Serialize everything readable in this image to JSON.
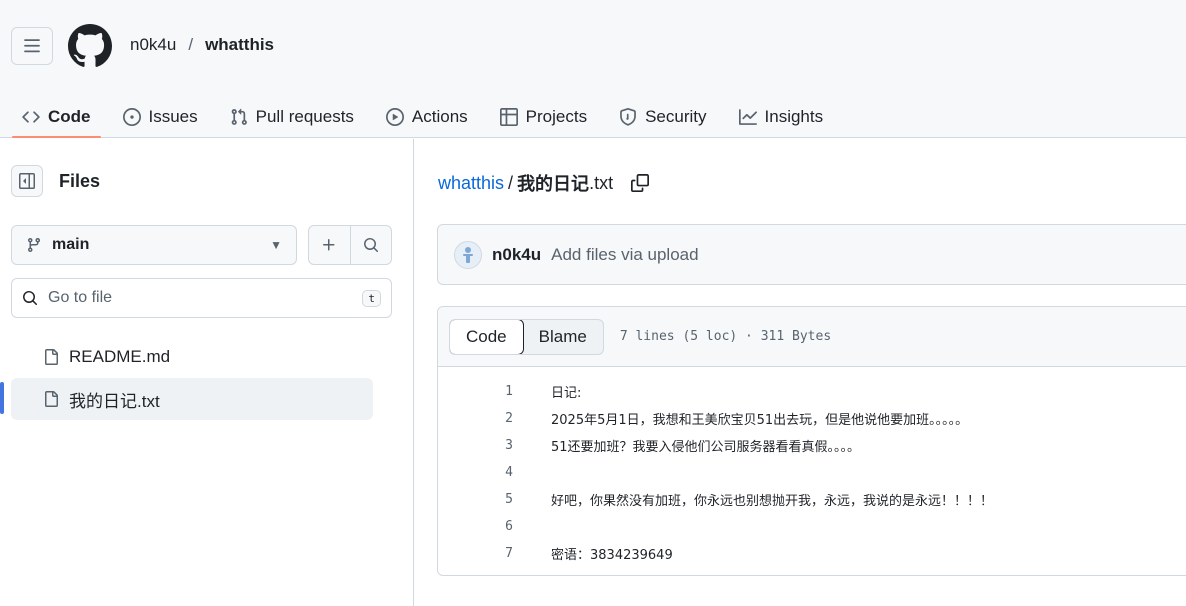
{
  "header": {
    "owner": "n0k4u",
    "separator": "/",
    "repo": "whatthis",
    "tabs": [
      {
        "label": "Code",
        "icon": "code-icon",
        "active": true
      },
      {
        "label": "Issues",
        "icon": "issue-opened-icon"
      },
      {
        "label": "Pull requests",
        "icon": "git-pull-request-icon"
      },
      {
        "label": "Actions",
        "icon": "play-icon"
      },
      {
        "label": "Projects",
        "icon": "table-icon"
      },
      {
        "label": "Security",
        "icon": "shield-icon"
      },
      {
        "label": "Insights",
        "icon": "graph-icon"
      }
    ]
  },
  "sidebar": {
    "title": "Files",
    "branch": "main",
    "goto_placeholder": "Go to file",
    "goto_shortcut": "t",
    "items": [
      {
        "label": "README.md",
        "selected": false
      },
      {
        "label": "我的日记.txt",
        "selected": true
      }
    ]
  },
  "main": {
    "breadcrumb_root": "whatthis",
    "breadcrumb_sep": "/",
    "breadcrumb_file_bold": "我的日记",
    "breadcrumb_file_ext": ".txt",
    "commit_author": "n0k4u",
    "commit_message": "Add files via upload",
    "view_tabs": {
      "code": "Code",
      "blame": "Blame"
    },
    "file_meta": "7 lines (5 loc) · 311 Bytes",
    "lines": [
      {
        "n": "1",
        "text": "日记:"
      },
      {
        "n": "2",
        "text": "2025年5月1日，我想和王美欣宝贝51出去玩，但是他说他要加班。。。。。"
      },
      {
        "n": "3",
        "text": "51还要加班？我要入侵他们公司服务器看看真假。。。。"
      },
      {
        "n": "4",
        "text": ""
      },
      {
        "n": "5",
        "text": "好吧，你果然没有加班，你永远也别想抛开我，永远，我说的是永远！！！！"
      },
      {
        "n": "6",
        "text": ""
      },
      {
        "n": "7",
        "text": "密语：3834239649"
      }
    ]
  },
  "colors": {
    "accent": "#0969da",
    "tab_underline": "#fd8c73",
    "highlight": "#e3262b"
  }
}
